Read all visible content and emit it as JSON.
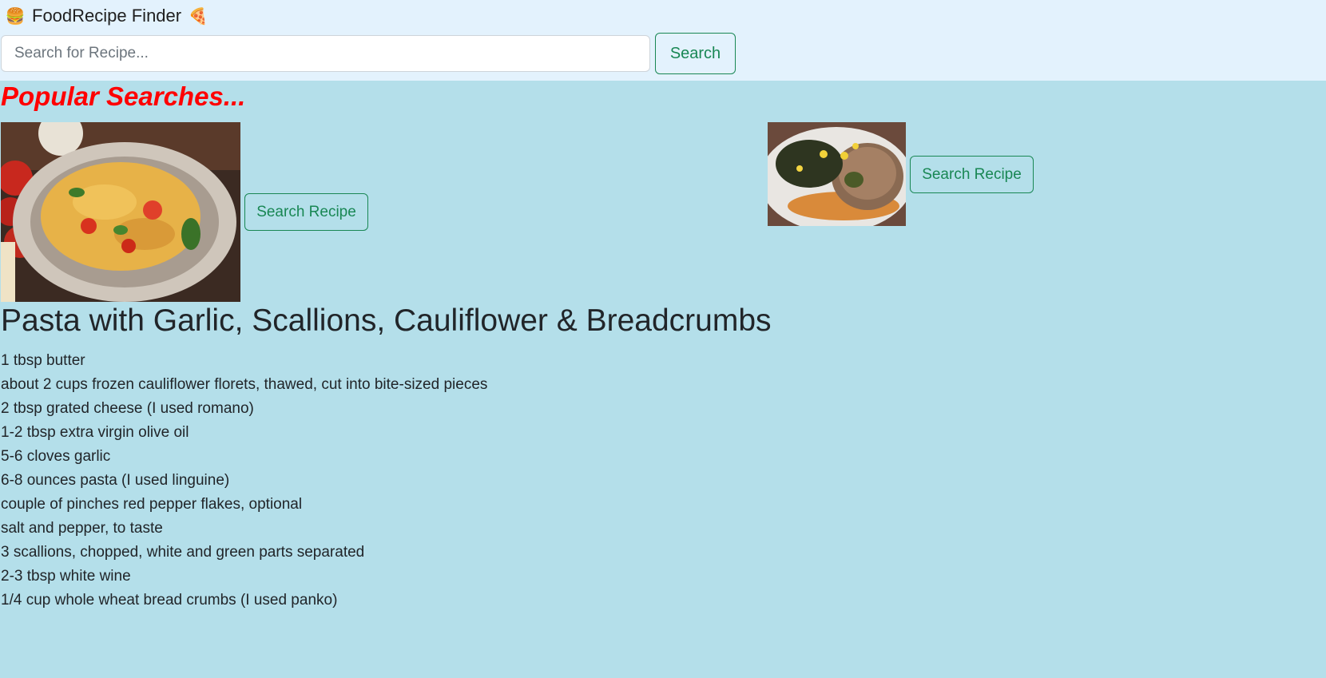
{
  "navbar": {
    "brand_left_emoji": "🍔",
    "brand_title": "FoodRecipe Finder",
    "brand_right_emoji": "🍕",
    "search_placeholder": "Search for Recipe...",
    "search_button": "Search"
  },
  "popular": {
    "heading": "Popular Searches...",
    "items": [
      {
        "image": "pasta-image",
        "button": "Search Recipe"
      },
      {
        "image": "pork-chop-image",
        "button": "Search Recipe"
      }
    ]
  },
  "recipe": {
    "title": "Pasta with Garlic, Scallions, Cauliflower & Breadcrumbs",
    "ingredients": [
      "1 tbsp butter",
      "about 2 cups frozen cauliflower florets, thawed, cut into bite-sized pieces",
      "2 tbsp grated cheese (I used romano)",
      "1-2 tbsp extra virgin olive oil",
      "5-6 cloves garlic",
      "6-8 ounces pasta (I used linguine)",
      "couple of pinches red pepper flakes, optional",
      "salt and pepper, to taste",
      "3 scallions, chopped, white and green parts separated",
      "2-3 tbsp white wine",
      "1/4 cup whole wheat bread crumbs (I used panko)"
    ]
  },
  "colors": {
    "navbar_bg": "#e3f2fd",
    "page_bg": "#b4dfea",
    "accent_green": "#198754",
    "heading_red": "#ff0000"
  }
}
